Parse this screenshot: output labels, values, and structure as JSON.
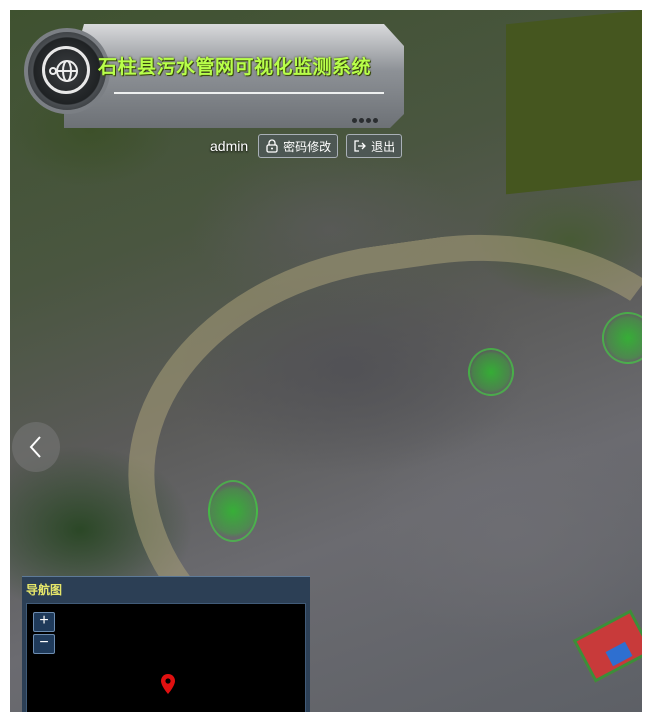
{
  "header": {
    "app_title": "石柱县污水管网可视化监测系统",
    "logo_icon": "globe-network-icon"
  },
  "userbar": {
    "username": "admin",
    "change_password_label": "密码修改",
    "logout_label": "退出"
  },
  "navigator": {
    "title": "导航图",
    "zoom_in_label": "+",
    "zoom_out_label": "−"
  },
  "colors": {
    "title_green": "#b8ff4a",
    "marker_red": "#e01010",
    "monitor_green": "#3cd03c"
  }
}
